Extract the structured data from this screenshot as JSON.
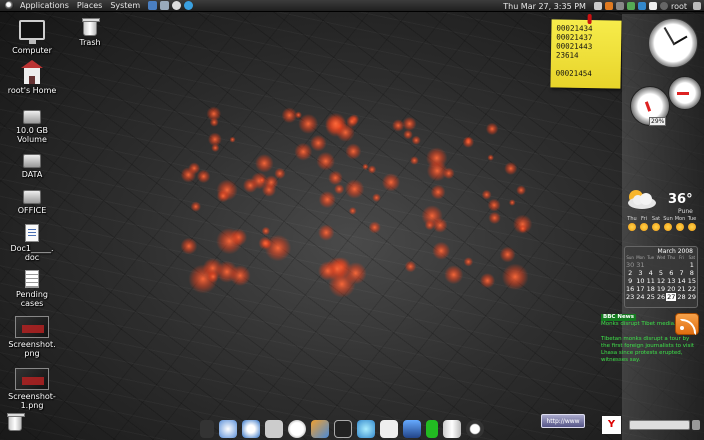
{
  "top_panel": {
    "menus": [
      "Applications",
      "Places",
      "System"
    ],
    "clock": "Thu Mar 27,  3:35 PM",
    "user": "root"
  },
  "desktop_icons": [
    {
      "label": "Computer",
      "icon": "monitor-icon"
    },
    {
      "label": "root's Home",
      "icon": "home-folder-icon"
    },
    {
      "label": "10.0 GB Volume",
      "icon": "drive-icon"
    },
    {
      "label": "DATA",
      "icon": "drive-icon"
    },
    {
      "label": "OFFICE",
      "icon": "drive-icon"
    },
    {
      "label": "Doc1_____.doc",
      "icon": "document-icon"
    },
    {
      "label": "Pending cases",
      "icon": "text-file-icon"
    },
    {
      "label": "Screenshot.png",
      "icon": "image-file-icon"
    },
    {
      "label": "Screenshot-1.png",
      "icon": "image-file-icon"
    },
    {
      "label": "Trash",
      "icon": "trash-icon"
    }
  ],
  "sticky_note": {
    "lines": [
      "00021434",
      "00021437",
      "00021443",
      "23614",
      "",
      "00021454"
    ]
  },
  "gauge": {
    "percent": "29%"
  },
  "weather": {
    "temperature": "36°",
    "city": "Pune",
    "days": [
      "Thu",
      "Fri",
      "Sat",
      "Sun",
      "Mon",
      "Tue"
    ]
  },
  "calendar": {
    "title": "March 2008",
    "weekdays": [
      "Sun",
      "Mon",
      "Tue",
      "Wed",
      "Thu",
      "Fri",
      "Sat"
    ],
    "days": [
      "",
      "",
      "",
      "",
      "",
      "",
      "1",
      "2",
      "3",
      "4",
      "5",
      "6",
      "7",
      "8",
      "9",
      "10",
      "11",
      "12",
      "13",
      "14",
      "15",
      "16",
      "17",
      "18",
      "19",
      "20",
      "21",
      "22",
      "23",
      "24",
      "25",
      "26",
      "27",
      "28",
      "29"
    ],
    "prev_row": [
      "30",
      "31"
    ],
    "today": "27"
  },
  "news": {
    "source": "BBC News",
    "headline": "Monks disrupt Tibet media...",
    "body": "Tibetan monks disrupt a tour by the first foreign journalists to visit Lhasa since protests erupted, witnesses say."
  },
  "url_button": "http://www",
  "colors": {
    "accent_red": "#e8401c",
    "sticky_yellow": "#f6ec4b",
    "news_green": "#3ee24a"
  }
}
